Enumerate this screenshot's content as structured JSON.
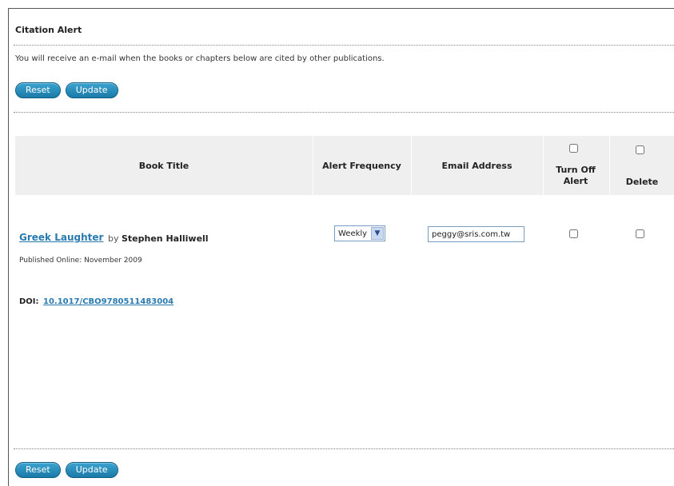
{
  "page": {
    "title": "Citation Alert",
    "intro": "You will receive an e-mail when the books or chapters below are cited by other publications."
  },
  "buttons": {
    "reset": "Reset",
    "update": "Update"
  },
  "table": {
    "headers": {
      "book_title": "Book Title",
      "alert_frequency": "Alert Frequency",
      "email_address": "Email Address",
      "turn_off_alert": "Turn Off Alert",
      "delete": "Delete"
    },
    "row": {
      "book_title": "Greek Laughter",
      "by": "by",
      "author": "Stephen Halliwell",
      "published": "Published Online: November 2009",
      "doi_label": "DOI:",
      "doi": "10.1017/CBO9780511483004",
      "frequency": "Weekly",
      "email": "peggy@sris.com.tw"
    }
  },
  "icons": {
    "dropdown": "chevron-down-icon"
  }
}
